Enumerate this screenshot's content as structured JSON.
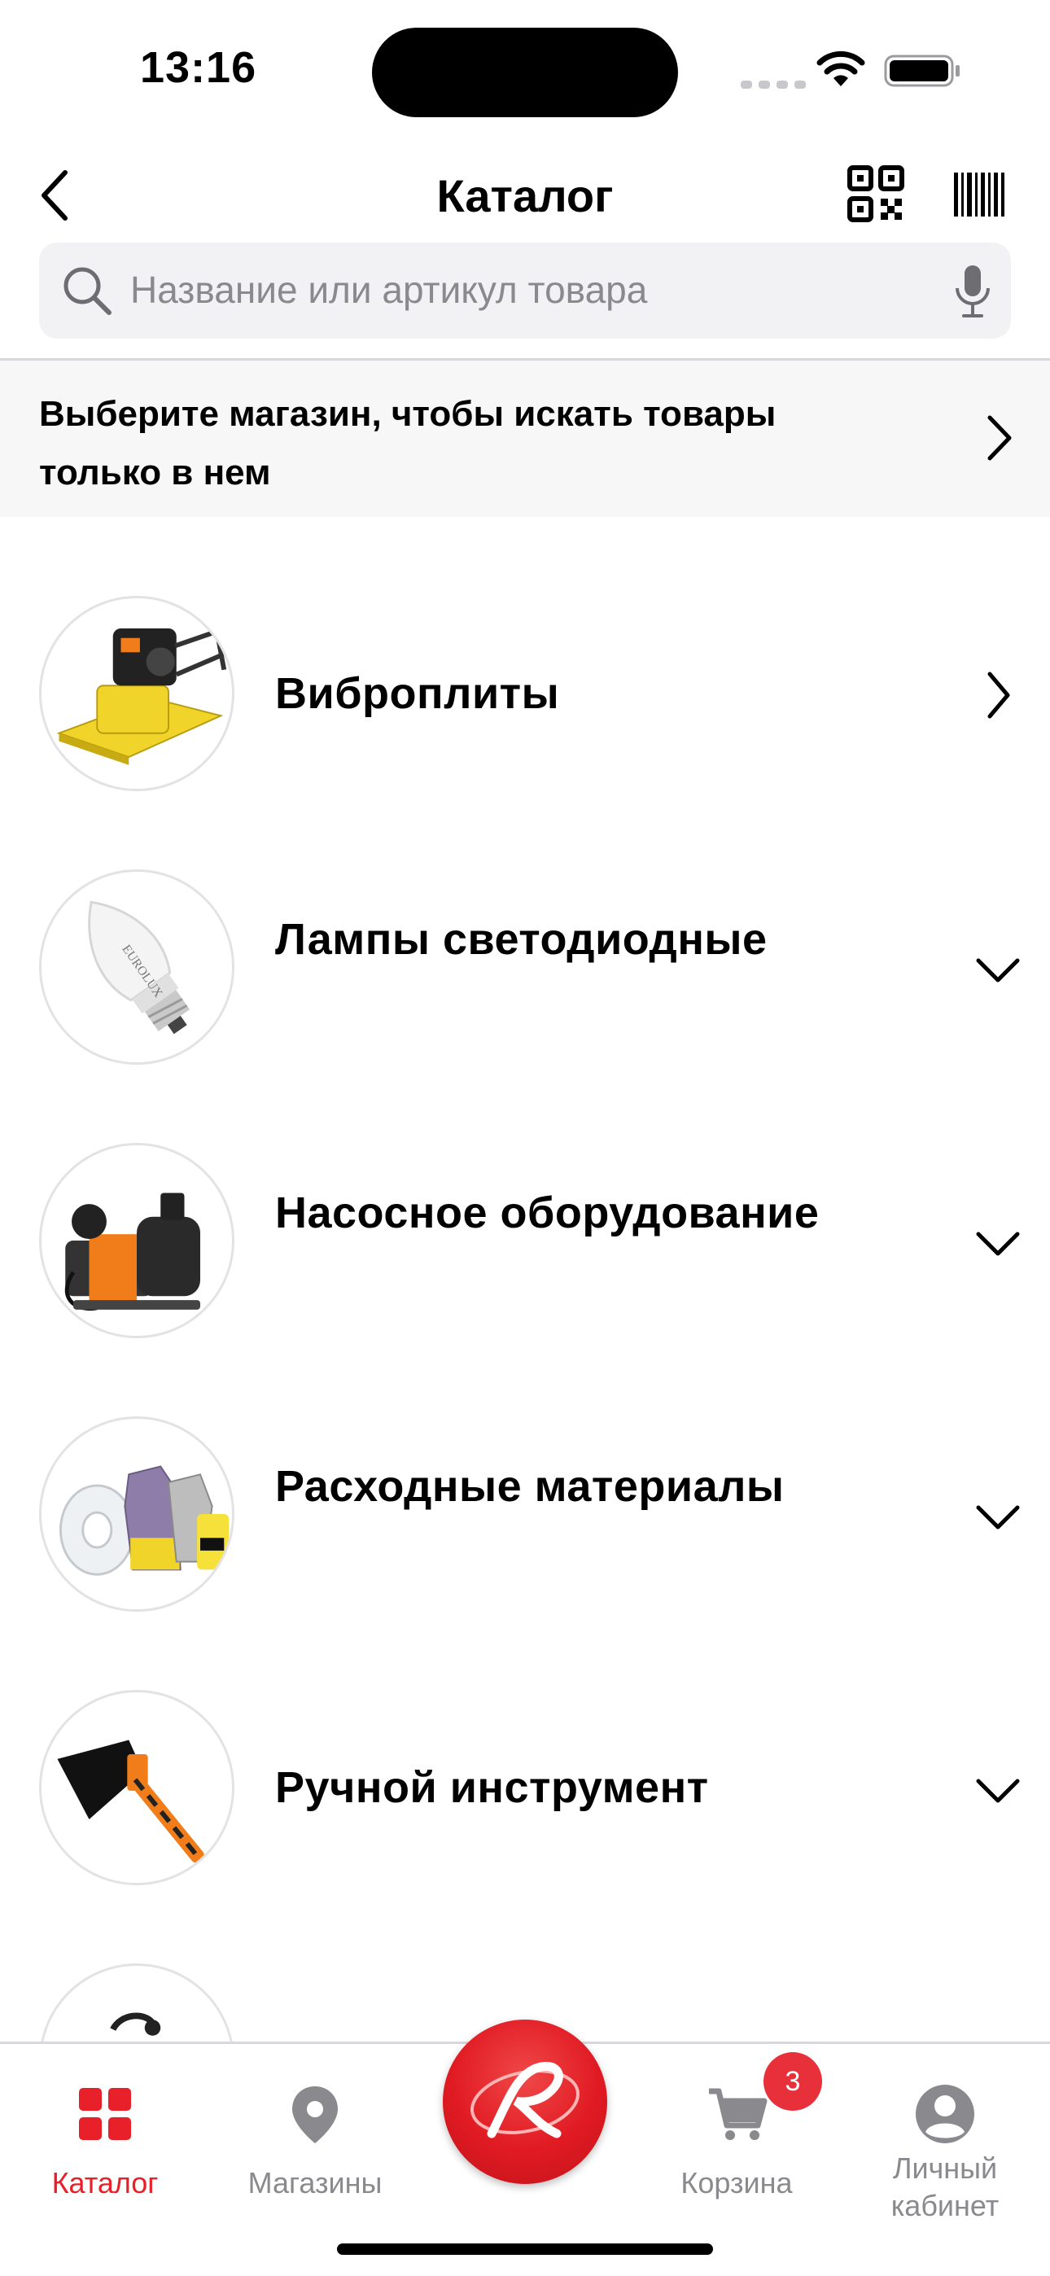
{
  "status_bar": {
    "time": "13:16"
  },
  "header": {
    "title": "Каталог",
    "back_icon": "chevron-left-icon",
    "qr_icon": "qr-code-icon",
    "barcode_icon": "barcode-icon"
  },
  "search": {
    "placeholder": "Название или артикул товара",
    "value": "",
    "search_icon": "search-icon",
    "mic_icon": "microphone-icon"
  },
  "store_banner": {
    "text": "Выберите магазин, чтобы искать товары только в нем",
    "chevron_icon": "chevron-right-icon"
  },
  "catalog": {
    "items": [
      {
        "label": "Виброплиты",
        "thumb": "vibratory-plate",
        "chevron": "chevron-right-icon"
      },
      {
        "label": "Лампы светодиодные",
        "thumb": "led-bulb",
        "chevron": "chevron-down-icon"
      },
      {
        "label": "Насосное оборудование",
        "thumb": "water-pump",
        "chevron": "chevron-down-icon"
      },
      {
        "label": "Расходные материалы",
        "thumb": "consumables",
        "chevron": "chevron-down-icon"
      },
      {
        "label": "Ручной инструмент",
        "thumb": "axe",
        "chevron": "chevron-down-icon"
      },
      {
        "label": "",
        "thumb": "partially-visible-item",
        "chevron": ""
      }
    ]
  },
  "tab_bar": {
    "tabs": [
      {
        "label": "Каталог",
        "icon": "grid-icon",
        "active": true
      },
      {
        "label": "Магазины",
        "icon": "map-pin-icon",
        "active": false
      },
      {
        "label": "Корзина",
        "icon": "cart-icon",
        "active": false,
        "badge": "3"
      },
      {
        "label": "Личный кабинет",
        "icon": "profile-icon",
        "active": false
      }
    ],
    "center_button_icon": "brand-logo-icon"
  },
  "colors": {
    "accent": "#e8202a",
    "inactive": "#8a8a8e",
    "search_bg": "#f2f2f4",
    "banner_bg": "#f7f7f7"
  }
}
